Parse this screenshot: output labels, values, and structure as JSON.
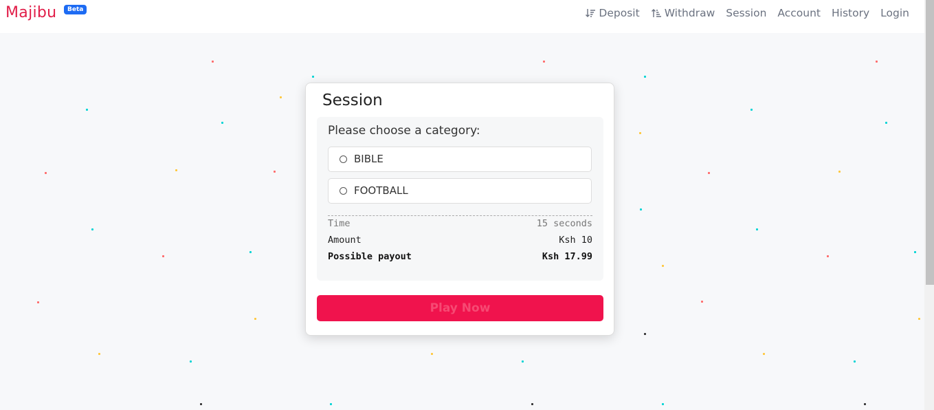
{
  "header": {
    "brand": "Majibu",
    "badge": "Beta",
    "nav": [
      {
        "label": "Deposit",
        "icon": "sort-down-icon"
      },
      {
        "label": "Withdraw",
        "icon": "sort-up-icon"
      },
      {
        "label": "Session"
      },
      {
        "label": "Account"
      },
      {
        "label": "History"
      },
      {
        "label": "Login"
      }
    ]
  },
  "session": {
    "title": "Session",
    "prompt": "Please choose a category:",
    "options": [
      "BIBLE",
      "FOOTBALL"
    ],
    "time_label": "Time",
    "time_value": "15 seconds",
    "amount_label": "Amount",
    "amount_value": "Ksh 10",
    "payout_label": "Possible payout",
    "payout_value": "Ksh 17.99",
    "play_label": "Play Now"
  },
  "colors": {
    "brand": "#e11d48",
    "badge": "#1d6bf3",
    "play_button": "#f0134d",
    "confetti": [
      "#00d4d4",
      "#ffc83d",
      "#ff6b6b",
      "#333333"
    ]
  }
}
